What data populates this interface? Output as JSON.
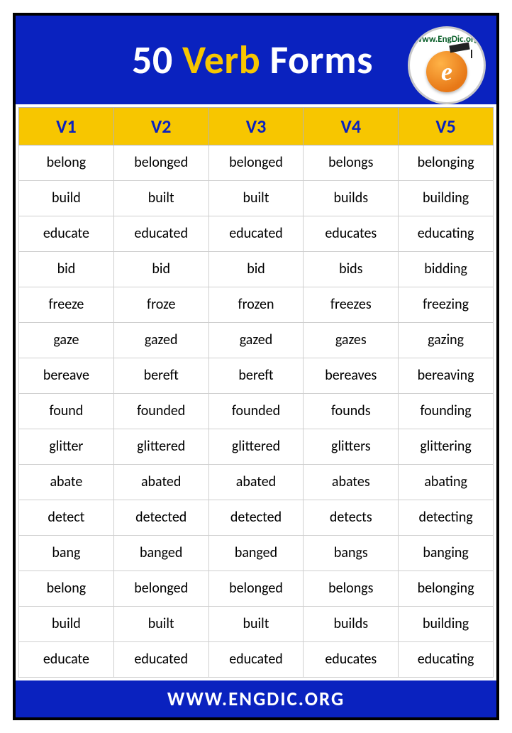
{
  "header": {
    "title_part1": "50",
    "title_part2": "Verb",
    "title_part3": "Forms",
    "logo_text": "www.EngDic.org"
  },
  "footer": {
    "text": "WWW.ENGDIC.ORG"
  },
  "table": {
    "headers": [
      "V1",
      "V2",
      "V3",
      "V4",
      "V5"
    ],
    "rows": [
      [
        "belong",
        "belonged",
        "belonged",
        "belongs",
        "belonging"
      ],
      [
        "build",
        "built",
        "built",
        "builds",
        "building"
      ],
      [
        "educate",
        "educated",
        "educated",
        "educates",
        "educating"
      ],
      [
        "bid",
        "bid",
        "bid",
        "bids",
        "bidding"
      ],
      [
        "freeze",
        "froze",
        "frozen",
        "freezes",
        "freezing"
      ],
      [
        "gaze",
        "gazed",
        "gazed",
        "gazes",
        "gazing"
      ],
      [
        "bereave",
        "bereft",
        "bereft",
        "bereaves",
        "bereaving"
      ],
      [
        "found",
        "founded",
        "founded",
        "founds",
        "founding"
      ],
      [
        "glitter",
        "glittered",
        "glittered",
        "glitters",
        "glittering"
      ],
      [
        "abate",
        "abated",
        "abated",
        "abates",
        "abating"
      ],
      [
        "detect",
        "detected",
        "detected",
        "detects",
        "detecting"
      ],
      [
        "bang",
        "banged",
        "banged",
        "bangs",
        "banging"
      ],
      [
        "belong",
        "belonged",
        "belonged",
        "belongs",
        "belonging"
      ],
      [
        "build",
        "built",
        "built",
        "builds",
        "building"
      ],
      [
        "educate",
        "educated",
        "educated",
        "educates",
        "educating"
      ]
    ]
  },
  "chart_data": {
    "type": "table",
    "title": "50 Verb Forms",
    "columns": [
      "V1",
      "V2",
      "V3",
      "V4",
      "V5"
    ],
    "rows": [
      [
        "belong",
        "belonged",
        "belonged",
        "belongs",
        "belonging"
      ],
      [
        "build",
        "built",
        "built",
        "builds",
        "building"
      ],
      [
        "educate",
        "educated",
        "educated",
        "educates",
        "educating"
      ],
      [
        "bid",
        "bid",
        "bid",
        "bids",
        "bidding"
      ],
      [
        "freeze",
        "froze",
        "frozen",
        "freezes",
        "freezing"
      ],
      [
        "gaze",
        "gazed",
        "gazed",
        "gazes",
        "gazing"
      ],
      [
        "bereave",
        "bereft",
        "bereft",
        "bereaves",
        "bereaving"
      ],
      [
        "found",
        "founded",
        "founded",
        "founds",
        "founding"
      ],
      [
        "glitter",
        "glittered",
        "glittered",
        "glitters",
        "glittering"
      ],
      [
        "abate",
        "abated",
        "abated",
        "abates",
        "abating"
      ],
      [
        "detect",
        "detected",
        "detected",
        "detects",
        "detecting"
      ],
      [
        "bang",
        "banged",
        "banged",
        "bangs",
        "banging"
      ],
      [
        "belong",
        "belonged",
        "belonged",
        "belongs",
        "belonging"
      ],
      [
        "build",
        "built",
        "built",
        "builds",
        "building"
      ],
      [
        "educate",
        "educated",
        "educated",
        "educates",
        "educating"
      ]
    ]
  }
}
